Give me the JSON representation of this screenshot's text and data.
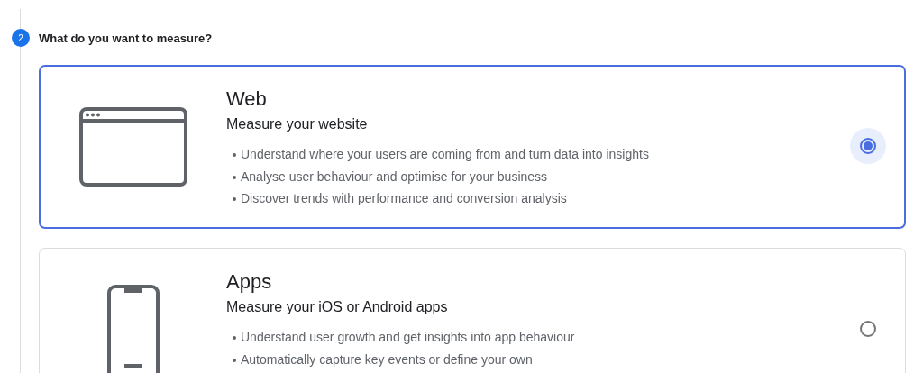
{
  "step": {
    "number": "2",
    "title": "What do you want to measure?"
  },
  "options": [
    {
      "kind": "web",
      "title": "Web",
      "subtitle": "Measure your website",
      "selected": true,
      "bullets": [
        "Understand where your users are coming from and turn data into insights",
        "Analyse user behaviour and optimise for your business",
        "Discover trends with performance and conversion analysis"
      ]
    },
    {
      "kind": "app",
      "title": "Apps",
      "subtitle": "Measure your iOS or Android apps",
      "selected": false,
      "bullets": [
        "Understand user growth and get insights into app behaviour",
        "Automatically capture key events or define your own"
      ]
    }
  ]
}
